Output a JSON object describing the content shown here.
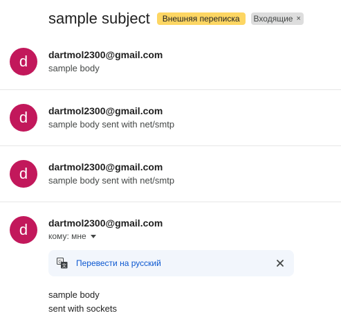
{
  "subject": {
    "title": "sample subject",
    "labels": {
      "external": "Внешняя переписка",
      "inbox": "Входящие",
      "inbox_remove": "×"
    }
  },
  "messages": [
    {
      "avatar_letter": "d",
      "sender": "dartmol2300@gmail.com",
      "snippet": "sample body"
    },
    {
      "avatar_letter": "d",
      "sender": "dartmol2300@gmail.com",
      "snippet": "sample body sent with net/smtp"
    },
    {
      "avatar_letter": "d",
      "sender": "dartmol2300@gmail.com",
      "snippet": "sample body sent with net/smtp"
    }
  ],
  "expanded_message": {
    "avatar_letter": "d",
    "sender": "dartmol2300@gmail.com",
    "to_line": "кому: мне",
    "translate": {
      "link_text": "Перевести на русский",
      "icon": "translate-icon",
      "close_icon": "close-icon"
    },
    "body_lines": [
      "sample body",
      "sent with sockets"
    ]
  },
  "colors": {
    "avatar": "#c2185b",
    "external_label": "#fdd663",
    "inbox_label": "#dddddd",
    "translate_bar": "#f2f6fc",
    "link": "#0b57d0"
  }
}
